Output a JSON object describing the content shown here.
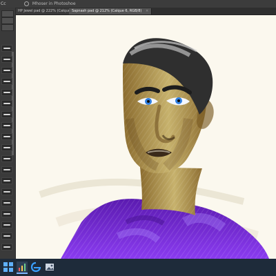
{
  "menubar": {
    "brand": "Cc",
    "search_text": "Mhoser in Photoshoe"
  },
  "tabs": [
    {
      "label": "HP Jewel pad @ 222% (Calque 1, RGB/8)",
      "active": false,
      "close": "×"
    },
    {
      "label": "Sapnash pad @ 212% (Calque 6, RGB/8)",
      "active": true,
      "close": "×"
    }
  ],
  "colors": {
    "canvas_bg": "#fbf8ee",
    "accent": "#7fb6ff",
    "shirt": "#7a2fd8",
    "skin": "#c6b06a",
    "hair": "#3a3a3a",
    "eyes": "#2f7fe0"
  },
  "left_panel": {
    "icons": [
      "brush-presets-icon",
      "settings-icon"
    ]
  },
  "taskbar": {
    "items": [
      {
        "icon": "start-icon"
      },
      {
        "icon": "activity-icon"
      },
      {
        "icon": "edge-icon"
      },
      {
        "icon": "photos-icon"
      }
    ]
  }
}
